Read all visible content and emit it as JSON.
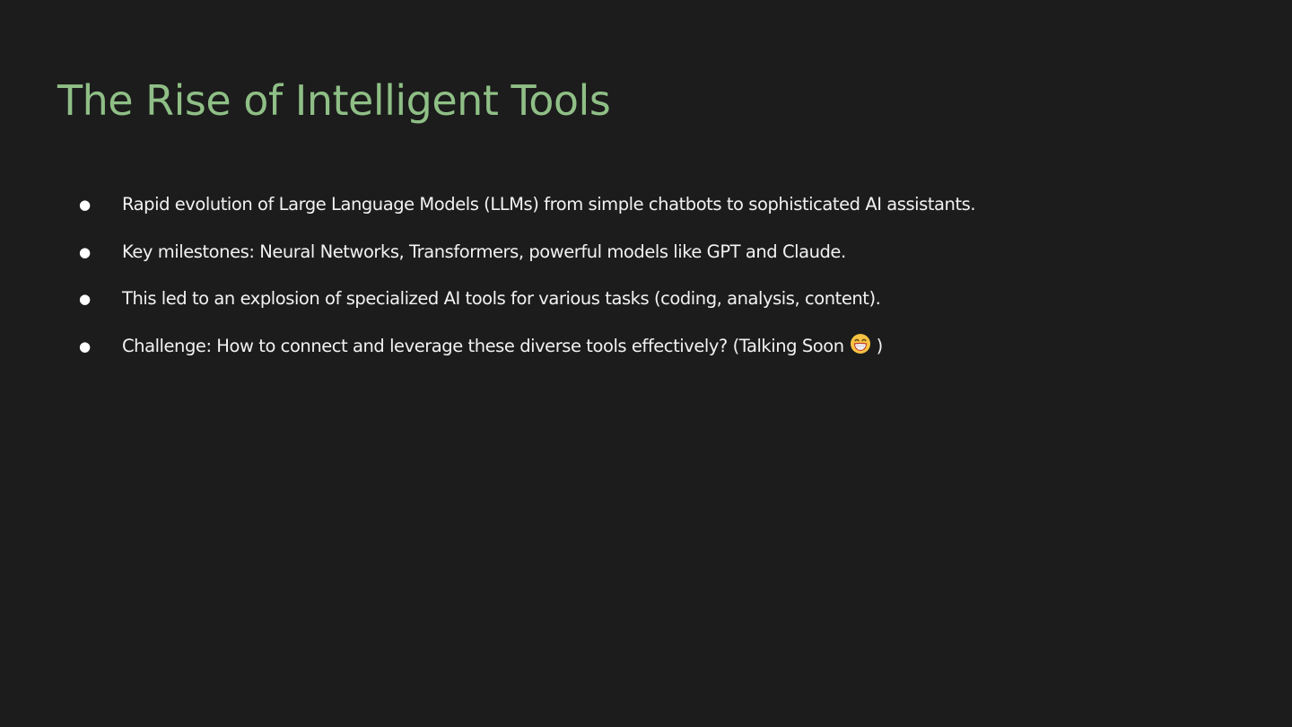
{
  "slide": {
    "title": "The Rise of Intelligent Tools",
    "background_color": "#1c1c1c",
    "title_color": "#8fbf86",
    "bullet_glyph": "●",
    "bullets": [
      {
        "text": "Rapid evolution of Large Language Models (LLMs) from simple chatbots to sophisticated AI assistants."
      },
      {
        "text": "Key milestones: Neural Networks, Transformers, powerful models like GPT and Claude."
      },
      {
        "text": "This led to an explosion of specialized AI tools for various tasks (coding, analysis, content)."
      },
      {
        "text": "Challenge: How to connect and leverage these diverse tools effectively?  (Talking Soon",
        "suffix": ")",
        "icon": "grinning-face-emoji-icon"
      }
    ]
  }
}
